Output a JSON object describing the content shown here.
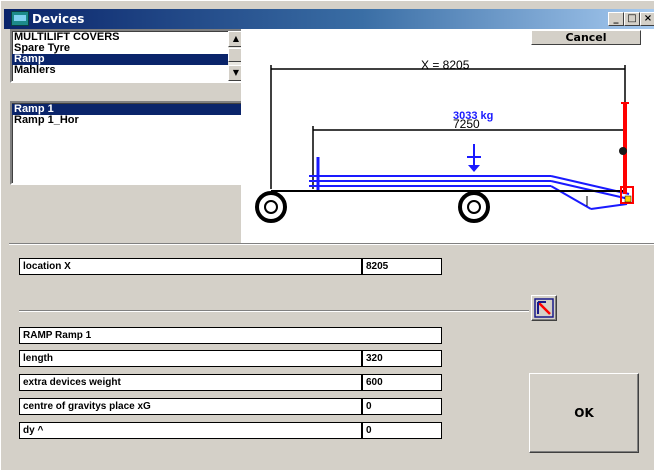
{
  "window": {
    "title": "Devices"
  },
  "titlebar_buttons": {
    "minimize": "_",
    "maximize": "□",
    "close": "×"
  },
  "device_list": {
    "items": [
      "MULTILIFT COVERS",
      "Spare Tyre",
      "Ramp",
      "Mahlers"
    ],
    "selected_index": 2
  },
  "variant_list": {
    "items": [
      "Ramp 1",
      "Ramp 1_Hor"
    ],
    "selected_index": 0
  },
  "cancel_button": "Cancel",
  "diagram": {
    "x_dimension": "X = 8205",
    "load_weight": "3033 kg",
    "ramp_dimension": "7250",
    "colors": {
      "trailer": "#1a1aff",
      "device": "#ff0000",
      "dim_lines": "#000000"
    }
  },
  "fields": {
    "location_label": "location   X",
    "location_value": "8205",
    "device_name": "RAMP  Ramp 1",
    "length_label": "length",
    "length_value": "320",
    "weight_label": "extra devices weight",
    "weight_value": "600",
    "cog_label": "centre of gravitys place  xG",
    "cog_value": "0",
    "dy_label": "dy    ^",
    "dy_value": "0"
  },
  "ok_button": "OK",
  "icons": {
    "app": "devices-app-icon",
    "edit": "edit-arrow-icon"
  }
}
